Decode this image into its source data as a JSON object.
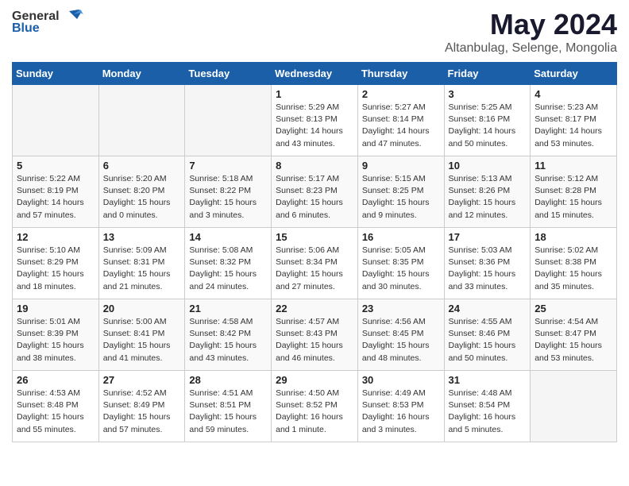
{
  "header": {
    "logo_general": "General",
    "logo_blue": "Blue",
    "month": "May 2024",
    "location": "Altanbulag, Selenge, Mongolia"
  },
  "weekdays": [
    "Sunday",
    "Monday",
    "Tuesday",
    "Wednesday",
    "Thursday",
    "Friday",
    "Saturday"
  ],
  "weeks": [
    [
      {
        "day": "",
        "info": ""
      },
      {
        "day": "",
        "info": ""
      },
      {
        "day": "",
        "info": ""
      },
      {
        "day": "1",
        "info": "Sunrise: 5:29 AM\nSunset: 8:13 PM\nDaylight: 14 hours\nand 43 minutes."
      },
      {
        "day": "2",
        "info": "Sunrise: 5:27 AM\nSunset: 8:14 PM\nDaylight: 14 hours\nand 47 minutes."
      },
      {
        "day": "3",
        "info": "Sunrise: 5:25 AM\nSunset: 8:16 PM\nDaylight: 14 hours\nand 50 minutes."
      },
      {
        "day": "4",
        "info": "Sunrise: 5:23 AM\nSunset: 8:17 PM\nDaylight: 14 hours\nand 53 minutes."
      }
    ],
    [
      {
        "day": "5",
        "info": "Sunrise: 5:22 AM\nSunset: 8:19 PM\nDaylight: 14 hours\nand 57 minutes."
      },
      {
        "day": "6",
        "info": "Sunrise: 5:20 AM\nSunset: 8:20 PM\nDaylight: 15 hours\nand 0 minutes."
      },
      {
        "day": "7",
        "info": "Sunrise: 5:18 AM\nSunset: 8:22 PM\nDaylight: 15 hours\nand 3 minutes."
      },
      {
        "day": "8",
        "info": "Sunrise: 5:17 AM\nSunset: 8:23 PM\nDaylight: 15 hours\nand 6 minutes."
      },
      {
        "day": "9",
        "info": "Sunrise: 5:15 AM\nSunset: 8:25 PM\nDaylight: 15 hours\nand 9 minutes."
      },
      {
        "day": "10",
        "info": "Sunrise: 5:13 AM\nSunset: 8:26 PM\nDaylight: 15 hours\nand 12 minutes."
      },
      {
        "day": "11",
        "info": "Sunrise: 5:12 AM\nSunset: 8:28 PM\nDaylight: 15 hours\nand 15 minutes."
      }
    ],
    [
      {
        "day": "12",
        "info": "Sunrise: 5:10 AM\nSunset: 8:29 PM\nDaylight: 15 hours\nand 18 minutes."
      },
      {
        "day": "13",
        "info": "Sunrise: 5:09 AM\nSunset: 8:31 PM\nDaylight: 15 hours\nand 21 minutes."
      },
      {
        "day": "14",
        "info": "Sunrise: 5:08 AM\nSunset: 8:32 PM\nDaylight: 15 hours\nand 24 minutes."
      },
      {
        "day": "15",
        "info": "Sunrise: 5:06 AM\nSunset: 8:34 PM\nDaylight: 15 hours\nand 27 minutes."
      },
      {
        "day": "16",
        "info": "Sunrise: 5:05 AM\nSunset: 8:35 PM\nDaylight: 15 hours\nand 30 minutes."
      },
      {
        "day": "17",
        "info": "Sunrise: 5:03 AM\nSunset: 8:36 PM\nDaylight: 15 hours\nand 33 minutes."
      },
      {
        "day": "18",
        "info": "Sunrise: 5:02 AM\nSunset: 8:38 PM\nDaylight: 15 hours\nand 35 minutes."
      }
    ],
    [
      {
        "day": "19",
        "info": "Sunrise: 5:01 AM\nSunset: 8:39 PM\nDaylight: 15 hours\nand 38 minutes."
      },
      {
        "day": "20",
        "info": "Sunrise: 5:00 AM\nSunset: 8:41 PM\nDaylight: 15 hours\nand 41 minutes."
      },
      {
        "day": "21",
        "info": "Sunrise: 4:58 AM\nSunset: 8:42 PM\nDaylight: 15 hours\nand 43 minutes."
      },
      {
        "day": "22",
        "info": "Sunrise: 4:57 AM\nSunset: 8:43 PM\nDaylight: 15 hours\nand 46 minutes."
      },
      {
        "day": "23",
        "info": "Sunrise: 4:56 AM\nSunset: 8:45 PM\nDaylight: 15 hours\nand 48 minutes."
      },
      {
        "day": "24",
        "info": "Sunrise: 4:55 AM\nSunset: 8:46 PM\nDaylight: 15 hours\nand 50 minutes."
      },
      {
        "day": "25",
        "info": "Sunrise: 4:54 AM\nSunset: 8:47 PM\nDaylight: 15 hours\nand 53 minutes."
      }
    ],
    [
      {
        "day": "26",
        "info": "Sunrise: 4:53 AM\nSunset: 8:48 PM\nDaylight: 15 hours\nand 55 minutes."
      },
      {
        "day": "27",
        "info": "Sunrise: 4:52 AM\nSunset: 8:49 PM\nDaylight: 15 hours\nand 57 minutes."
      },
      {
        "day": "28",
        "info": "Sunrise: 4:51 AM\nSunset: 8:51 PM\nDaylight: 15 hours\nand 59 minutes."
      },
      {
        "day": "29",
        "info": "Sunrise: 4:50 AM\nSunset: 8:52 PM\nDaylight: 16 hours\nand 1 minute."
      },
      {
        "day": "30",
        "info": "Sunrise: 4:49 AM\nSunset: 8:53 PM\nDaylight: 16 hours\nand 3 minutes."
      },
      {
        "day": "31",
        "info": "Sunrise: 4:48 AM\nSunset: 8:54 PM\nDaylight: 16 hours\nand 5 minutes."
      },
      {
        "day": "",
        "info": ""
      }
    ]
  ]
}
